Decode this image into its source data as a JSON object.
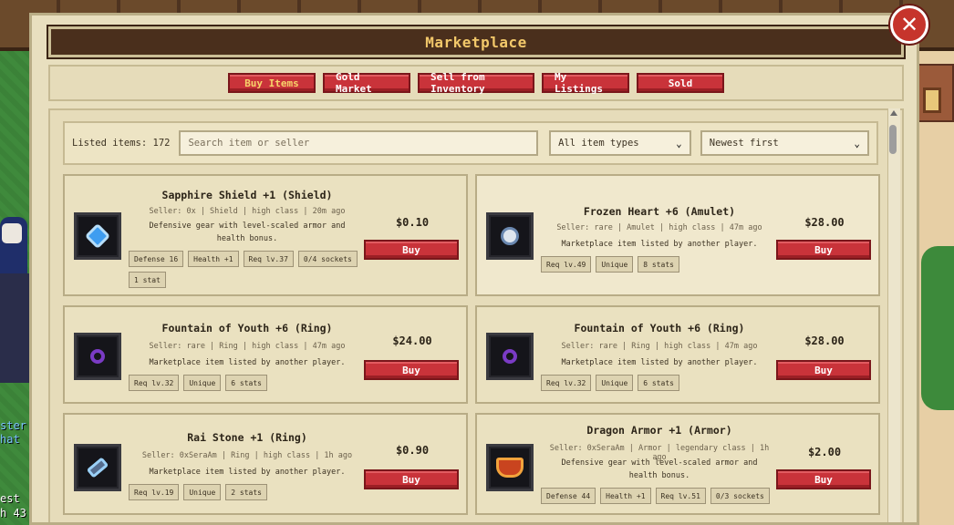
{
  "window": {
    "title": "Marketplace",
    "close_symbol": "✕"
  },
  "tabs": [
    {
      "label": "Buy Items",
      "active": true
    },
    {
      "label": "Gold Market",
      "active": false
    },
    {
      "label": "Sell from Inventory",
      "active": false
    },
    {
      "label": "My Listings",
      "active": false
    },
    {
      "label": "Sold",
      "active": false
    }
  ],
  "filters": {
    "listed_label": "Listed items: 172",
    "search_placeholder": "Search item or seller",
    "type_select": "All item types",
    "sort_select": "Newest first"
  },
  "listings": [
    {
      "name": "Sapphire Shield +1 (Shield)",
      "seller": "Seller: 0x | Shield | high class | 20m ago",
      "description": "Defensive gear with level-scaled armor and health bonus.",
      "tags": [
        "Defense 16",
        "Health +1",
        "Req lv.37",
        "0/4 sockets",
        "1 stat"
      ],
      "price": "$0.10",
      "buy_label": "Buy",
      "icon": "sapphire-shield-icon"
    },
    {
      "name": "Frozen Heart +6 (Amulet)",
      "seller": "Seller: rare | Amulet | high class | 47m ago",
      "description": "Marketplace item listed by another player.",
      "tags": [
        "Req lv.49",
        "Unique",
        "8 stats"
      ],
      "price": "$28.00",
      "buy_label": "Buy",
      "icon": "frozen-heart-amulet-icon"
    },
    {
      "name": "Fountain of Youth +6 (Ring)",
      "seller": "Seller: rare | Ring | high class | 47m ago",
      "description": "Marketplace item listed by another player.",
      "tags": [
        "Req lv.32",
        "Unique",
        "6 stats"
      ],
      "price": "$24.00",
      "buy_label": "Buy",
      "icon": "ring-icon"
    },
    {
      "name": "Fountain of Youth +6 (Ring)",
      "seller": "Seller: rare | Ring | high class | 47m ago",
      "description": "Marketplace item listed by another player.",
      "tags": [
        "Req lv.32",
        "Unique",
        "6 stats"
      ],
      "price": "$28.00",
      "buy_label": "Buy",
      "icon": "ring-icon"
    },
    {
      "name": "Rai Stone +1 (Ring)",
      "seller": "Seller: 0xSeraAm | Ring | high class | 1h ago",
      "description": "Marketplace item listed by another player.",
      "tags": [
        "Req lv.19",
        "Unique",
        "2 stats"
      ],
      "price": "$0.90",
      "buy_label": "Buy",
      "icon": "rai-stone-icon"
    },
    {
      "name": "Dragon Armor +1 (Armor)",
      "seller": "Seller: 0xSeraAm | Armor | legendary class | 1h ago",
      "description": "Defensive gear with level-scaled armor and health bonus.",
      "tags": [
        "Defense 44",
        "Health +1",
        "Req lv.51",
        "0/3 sockets"
      ],
      "price": "$2.00",
      "buy_label": "Buy",
      "icon": "dragon-armor-icon"
    }
  ],
  "background_text": {
    "chat_line1": "ster",
    "chat_line2": "hat",
    "bottom_line1": "est",
    "bottom_line2": "h 43"
  }
}
